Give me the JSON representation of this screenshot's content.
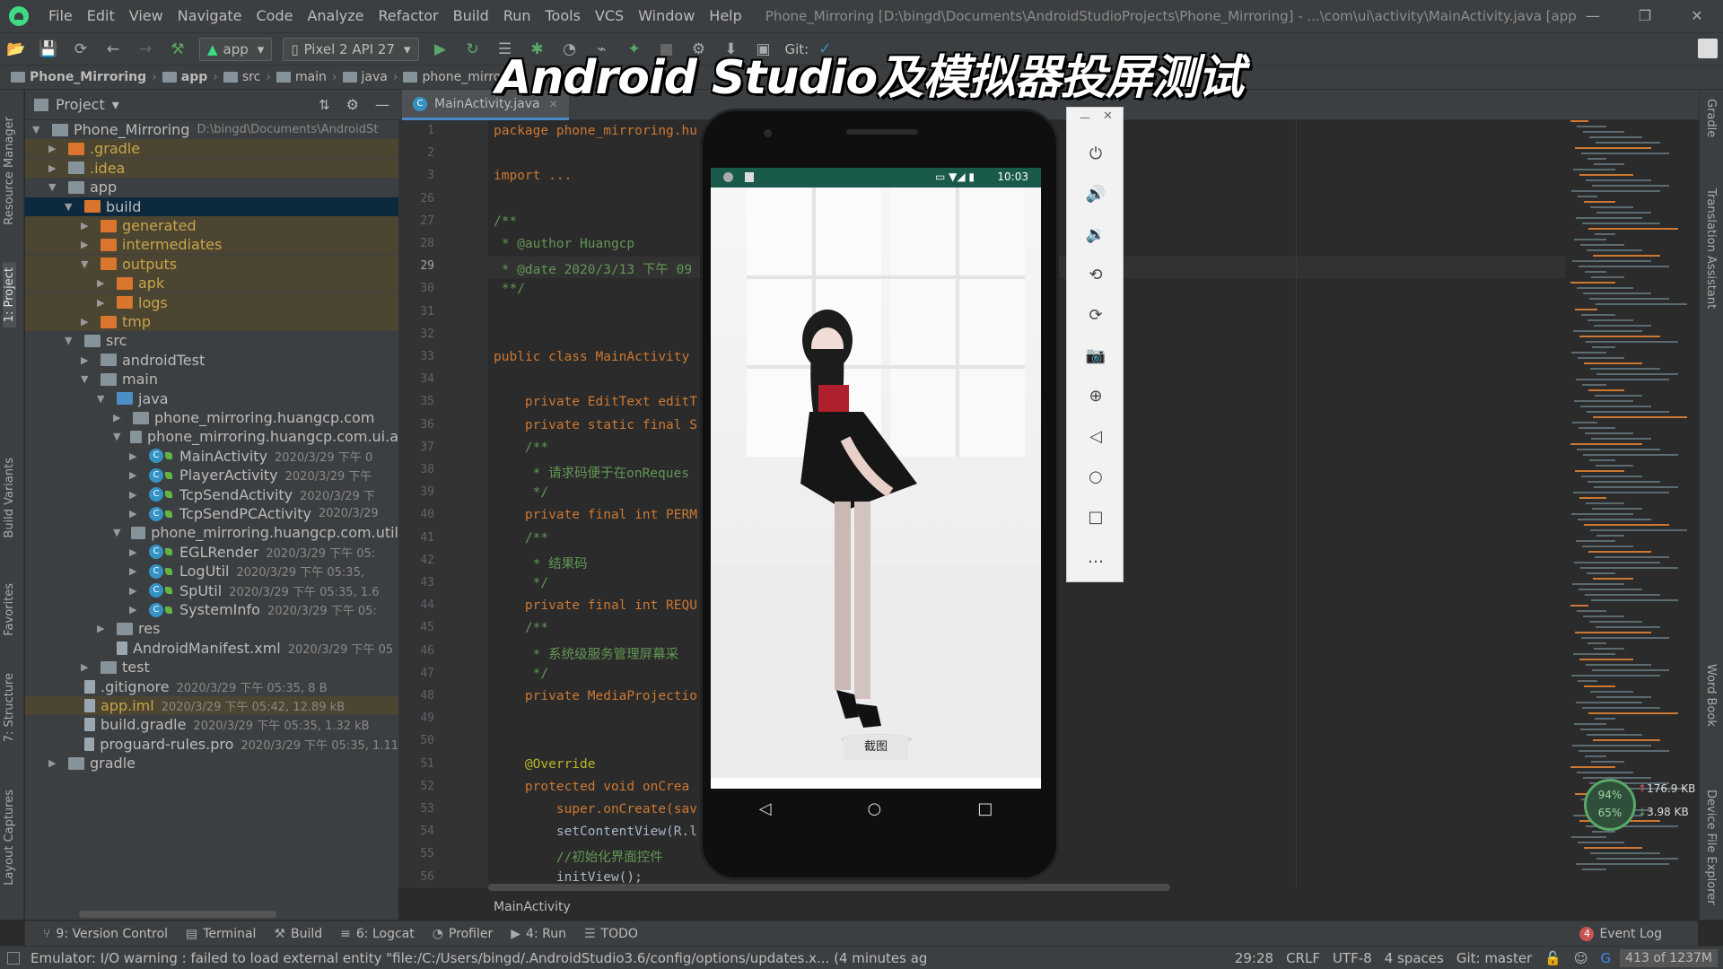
{
  "menu": {
    "items": [
      "File",
      "Edit",
      "View",
      "Navigate",
      "Code",
      "Analyze",
      "Refactor",
      "Build",
      "Run",
      "Tools",
      "VCS",
      "Window",
      "Help"
    ],
    "window_title": "Phone_Mirroring [D:\\bingd\\Documents\\AndroidStudioProjects\\Phone_Mirroring] - ...\\com\\ui\\activity\\MainActivity.java [app"
  },
  "toolbar": {
    "module": "app",
    "device": "Pixel 2 API 27",
    "git_label": "Git:"
  },
  "navbar": {
    "crumbs": [
      "Phone_Mirroring",
      "app",
      "src",
      "main",
      "java",
      "phone_mirroring"
    ]
  },
  "overlay_title": "Android Studio及模拟器投屏测试",
  "left_tabs": [
    "Resource Manager",
    "1: Project",
    "Build Variants",
    "Favorites",
    "7: Structure",
    "Layout Captures"
  ],
  "right_tabs": [
    "Gradle",
    "Translation Assistant",
    "Word Book",
    "Device File Explorer"
  ],
  "project": {
    "header": "Project",
    "tree": [
      {
        "label": "Phone_Mirroring",
        "meta": "D:\\bingd\\Documents\\AndroidSt",
        "level": 0,
        "arrow": "▼",
        "icon": "grey"
      },
      {
        "label": ".gradle",
        "meta": "",
        "level": 1,
        "arrow": "▶",
        "icon": "orange",
        "excluded": true
      },
      {
        "label": ".idea",
        "meta": "",
        "level": 1,
        "arrow": "▶",
        "icon": "grey",
        "excluded": true
      },
      {
        "label": "app",
        "meta": "",
        "level": 1,
        "arrow": "▼",
        "icon": "grey"
      },
      {
        "label": "build",
        "meta": "",
        "level": 2,
        "arrow": "▼",
        "icon": "orange",
        "selected": true
      },
      {
        "label": "generated",
        "meta": "",
        "level": 3,
        "arrow": "▶",
        "icon": "orange",
        "excluded": true
      },
      {
        "label": "intermediates",
        "meta": "",
        "level": 3,
        "arrow": "▶",
        "icon": "orange",
        "excluded": true
      },
      {
        "label": "outputs",
        "meta": "",
        "level": 3,
        "arrow": "▼",
        "icon": "orange",
        "excluded": true
      },
      {
        "label": "apk",
        "meta": "",
        "level": 4,
        "arrow": "▶",
        "icon": "orange",
        "excluded": true
      },
      {
        "label": "logs",
        "meta": "",
        "level": 4,
        "arrow": "▶",
        "icon": "orange",
        "excluded": true
      },
      {
        "label": "tmp",
        "meta": "",
        "level": 3,
        "arrow": "▶",
        "icon": "orange",
        "excluded": true
      },
      {
        "label": "src",
        "meta": "",
        "level": 2,
        "arrow": "▼",
        "icon": "grey"
      },
      {
        "label": "androidTest",
        "meta": "",
        "level": 3,
        "arrow": "▶",
        "icon": "grey"
      },
      {
        "label": "main",
        "meta": "",
        "level": 3,
        "arrow": "▼",
        "icon": "grey"
      },
      {
        "label": "java",
        "meta": "",
        "level": 4,
        "arrow": "▼",
        "icon": "blue"
      },
      {
        "label": "phone_mirroring.huangcp.com",
        "meta": "",
        "level": 5,
        "arrow": "▶",
        "icon": "grey"
      },
      {
        "label": "phone_mirroring.huangcp.com.ui.a",
        "meta": "",
        "level": 5,
        "arrow": "▼",
        "icon": "grey"
      },
      {
        "label": "MainActivity",
        "meta": "2020/3/29 下午 0",
        "level": 6,
        "arrow": "▶",
        "icon": "class"
      },
      {
        "label": "PlayerActivity",
        "meta": "2020/3/29 下午",
        "level": 6,
        "arrow": "▶",
        "icon": "class"
      },
      {
        "label": "TcpSendActivity",
        "meta": "2020/3/29 下",
        "level": 6,
        "arrow": "▶",
        "icon": "class"
      },
      {
        "label": "TcpSendPCActivity",
        "meta": "2020/3/29",
        "level": 6,
        "arrow": "▶",
        "icon": "class"
      },
      {
        "label": "phone_mirroring.huangcp.com.util",
        "meta": "",
        "level": 5,
        "arrow": "▼",
        "icon": "grey"
      },
      {
        "label": "EGLRender",
        "meta": "2020/3/29 下午 05:",
        "level": 6,
        "arrow": "▶",
        "icon": "class"
      },
      {
        "label": "LogUtil",
        "meta": "2020/3/29 下午 05:35,",
        "level": 6,
        "arrow": "▶",
        "icon": "class"
      },
      {
        "label": "SpUtil",
        "meta": "2020/3/29 下午 05:35, 1.6",
        "level": 6,
        "arrow": "▶",
        "icon": "class"
      },
      {
        "label": "SystemInfo",
        "meta": "2020/3/29 下午 05:",
        "level": 6,
        "arrow": "▶",
        "icon": "class"
      },
      {
        "label": "res",
        "meta": "",
        "level": 4,
        "arrow": "▶",
        "icon": "grey"
      },
      {
        "label": "AndroidManifest.xml",
        "meta": "2020/3/29 下午 05",
        "level": 4,
        "arrow": "",
        "icon": "file"
      },
      {
        "label": "test",
        "meta": "",
        "level": 3,
        "arrow": "▶",
        "icon": "grey"
      },
      {
        "label": ".gitignore",
        "meta": "2020/3/29 下午 05:35, 8 B",
        "level": 2,
        "arrow": "",
        "icon": "file"
      },
      {
        "label": "app.iml",
        "meta": "2020/3/29 下午 05:42, 12.89 kB",
        "level": 2,
        "arrow": "",
        "icon": "file",
        "excluded": true
      },
      {
        "label": "build.gradle",
        "meta": "2020/3/29 下午 05:35, 1.32 kB",
        "level": 2,
        "arrow": "",
        "icon": "file"
      },
      {
        "label": "proguard-rules.pro",
        "meta": "2020/3/29 下午 05:35, 1.11",
        "level": 2,
        "arrow": "",
        "icon": "file"
      },
      {
        "label": "gradle",
        "meta": "",
        "level": 1,
        "arrow": "▶",
        "icon": "grey"
      }
    ]
  },
  "editor": {
    "tab": "MainActivity.java",
    "line_numbers": [
      "1",
      "2",
      "3",
      "26",
      "27",
      "28",
      "29",
      "30",
      "31",
      "32",
      "33",
      "34",
      "35",
      "36",
      "37",
      "38",
      "39",
      "40",
      "41",
      "42",
      "43",
      "44",
      "45",
      "46",
      "47",
      "48",
      "49",
      "50",
      "51",
      "52",
      "53",
      "54",
      "55",
      "56"
    ],
    "lines": [
      "package phone_mirroring.hu",
      "",
      "import ...",
      "",
      "/**",
      " * @author Huangcp",
      " * @date 2020/3/13 下午 09",
      " **/",
      "",
      "",
      "public class MainActivity",
      "",
      "    private EditText editT",
      "    private static final S",
      "    /**",
      "     * 请求码便于在onReques",
      "     */",
      "    private final int PERM",
      "    /**",
      "     * 结果码",
      "     */",
      "    private final int REQU",
      "    /**",
      "     * 系统级服务管理屏幕采",
      "     */",
      "    private MediaProjectio",
      "",
      "",
      "    @Override",
      "    protected void onCrea",
      "        super.onCreate(sav",
      "        setContentView(R.l",
      "        //初始化界面控件",
      "        initView();"
    ],
    "breadcrumb": "MainActivity"
  },
  "phone": {
    "time": "10:03",
    "screen_button": "截图"
  },
  "emulator_panel": {
    "icons": [
      "power-icon",
      "volume-up-icon",
      "volume-down-icon",
      "rotate-left-icon",
      "rotate-right-icon",
      "camera-icon",
      "zoom-icon",
      "back-icon",
      "home-icon",
      "overview-icon",
      "more-icon"
    ]
  },
  "network_widget": {
    "cpu": "94%",
    "mem": "65%",
    "up": "176.9 KB",
    "down": "3.98 KB"
  },
  "bottom_tabs": [
    "9: Version Control",
    "Terminal",
    "Build",
    "6: Logcat",
    "Profiler",
    "4: Run",
    "TODO"
  ],
  "event_log": {
    "count": "4",
    "label": "Event Log"
  },
  "status": {
    "message": "Emulator: I/O warning : failed to load external entity \"file:/C:/Users/bingd/.AndroidStudio3.6/config/options/updates.x... (4 minutes ago)",
    "position": "29:28",
    "line_sep": "CRLF",
    "encoding": "UTF-8",
    "indent": "4 spaces",
    "git": "Git: master",
    "memory": "413 of 1237M"
  },
  "colors": {
    "accent": "#4a88c7",
    "bg": "#2b2b2b",
    "panel": "#3c3f41",
    "selection": "#0d293e"
  }
}
